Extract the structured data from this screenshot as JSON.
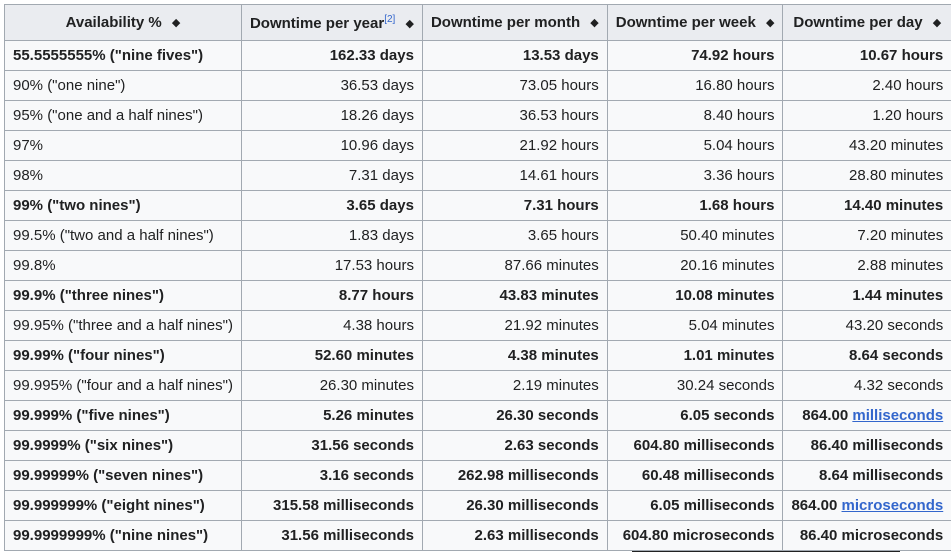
{
  "headers": {
    "availability": "Availability %",
    "year": "Downtime per year",
    "year_ref": "[2]",
    "month": "Downtime per month",
    "week": "Downtime per week",
    "day": "Downtime per day",
    "sort_symbol": "◆"
  },
  "rows": [
    {
      "availability": "55.5555555% (\"nine fives\")",
      "year": "162.33 days",
      "month": "13.53 days",
      "week": "74.92 hours",
      "day": "10.67 hours",
      "bold": true
    },
    {
      "availability": "90% (\"one nine\")",
      "year": "36.53 days",
      "month": "73.05 hours",
      "week": "16.80 hours",
      "day": "2.40 hours",
      "bold": false
    },
    {
      "availability": "95% (\"one and a half nines\")",
      "year": "18.26 days",
      "month": "36.53 hours",
      "week": "8.40 hours",
      "day": "1.20 hours",
      "bold": false
    },
    {
      "availability": "97%",
      "year": "10.96 days",
      "month": "21.92 hours",
      "week": "5.04 hours",
      "day": "43.20 minutes",
      "bold": false
    },
    {
      "availability": "98%",
      "year": "7.31 days",
      "month": "14.61 hours",
      "week": "3.36 hours",
      "day": "28.80 minutes",
      "bold": false
    },
    {
      "availability": "99% (\"two nines\")",
      "year": "3.65 days",
      "month": "7.31 hours",
      "week": "1.68 hours",
      "day": "14.40 minutes",
      "bold": true
    },
    {
      "availability": "99.5% (\"two and a half nines\")",
      "year": "1.83 days",
      "month": "3.65 hours",
      "week": "50.40 minutes",
      "day": "7.20 minutes",
      "bold": false
    },
    {
      "availability": "99.8%",
      "year": "17.53 hours",
      "month": "87.66 minutes",
      "week": "20.16 minutes",
      "day": "2.88 minutes",
      "bold": false
    },
    {
      "availability": "99.9% (\"three nines\")",
      "year": "8.77 hours",
      "month": "43.83 minutes",
      "week": "10.08 minutes",
      "day": "1.44 minutes",
      "bold": true
    },
    {
      "availability": "99.95% (\"three and a half nines\")",
      "year": "4.38 hours",
      "month": "21.92 minutes",
      "week": "5.04 minutes",
      "day": "43.20 seconds",
      "bold": false
    },
    {
      "availability": "99.99% (\"four nines\")",
      "year": "52.60 minutes",
      "month": "4.38 minutes",
      "week": "1.01 minutes",
      "day": "8.64 seconds",
      "bold": true
    },
    {
      "availability": "99.995% (\"four and a half nines\")",
      "year": "26.30 minutes",
      "month": "2.19 minutes",
      "week": "30.24 seconds",
      "day": "4.32 seconds",
      "bold": false
    },
    {
      "availability": "99.999% (\"five nines\")",
      "year": "5.26 minutes",
      "month": "26.30 seconds",
      "week": "6.05 seconds",
      "day": "864.00",
      "day_link": "milliseconds",
      "bold": true
    },
    {
      "availability": "99.9999% (\"six nines\")",
      "year": "31.56 seconds",
      "month": "2.63 seconds",
      "week": "604.80 milliseconds",
      "day": "86.40 milliseconds",
      "bold": true
    },
    {
      "availability": "99.99999% (\"seven nines\")",
      "year": "3.16 seconds",
      "month": "262.98 milliseconds",
      "week": "60.48 milliseconds",
      "day": "8.64 milliseconds",
      "bold": true
    },
    {
      "availability": "99.999999% (\"eight nines\")",
      "year": "315.58 milliseconds",
      "month": "26.30 milliseconds",
      "week": "6.05 milliseconds",
      "day": "864.00",
      "day_link": "microseconds",
      "bold": true
    },
    {
      "availability": "99.9999999% (\"nine nines\")",
      "year": "31.56 milliseconds",
      "month": "2.63 milliseconds",
      "week": "604.80 microseconds",
      "day": "86.40 microseconds",
      "bold": true
    }
  ],
  "colors": {
    "header_bg": "#eaecf0",
    "cell_bg": "#f8f9fa",
    "border": "#a2a9b1",
    "link": "#3366cc"
  }
}
